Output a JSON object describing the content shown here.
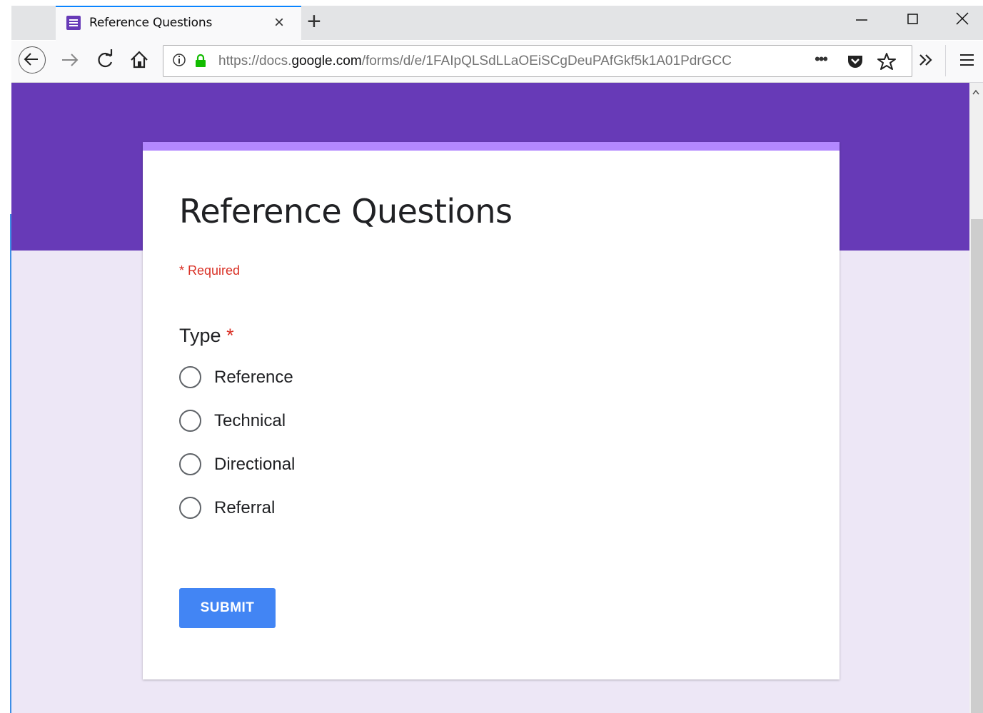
{
  "browser": {
    "tab_title": "Reference Questions",
    "tab_close_glyph": "×",
    "new_tab_glyph": "+",
    "url_scheme_path_prefix": "https://docs.",
    "url_host": "google.com",
    "url_rest": "/forms/d/e/1FAIpQLSdLLaOEiSCgDeuPAfGkf5k1A01PdrGCC",
    "url_dots": "•••",
    "icons": {
      "back": "arrow-left-icon",
      "forward": "arrow-right-icon",
      "reload": "reload-icon",
      "home": "home-icon",
      "info": "info-icon",
      "lock": "lock-icon",
      "pocket": "pocket-icon",
      "bookmark": "star-icon",
      "overflow": "chevron-double-right-icon",
      "menu": "hamburger-menu-icon"
    },
    "window_controls": [
      "minimize",
      "maximize",
      "close"
    ]
  },
  "form": {
    "title": "Reference Questions",
    "required_note": "* Required",
    "question": {
      "label": "Type",
      "required_star": "*",
      "options": [
        "Reference",
        "Technical",
        "Directional",
        "Referral"
      ]
    },
    "submit_label": "SUBMIT"
  },
  "colors": {
    "banner": "#673ab7",
    "card_stripe": "#b388ff",
    "page_background": "#ede7f6",
    "submit": "#4285f4",
    "required": "#d93025"
  }
}
